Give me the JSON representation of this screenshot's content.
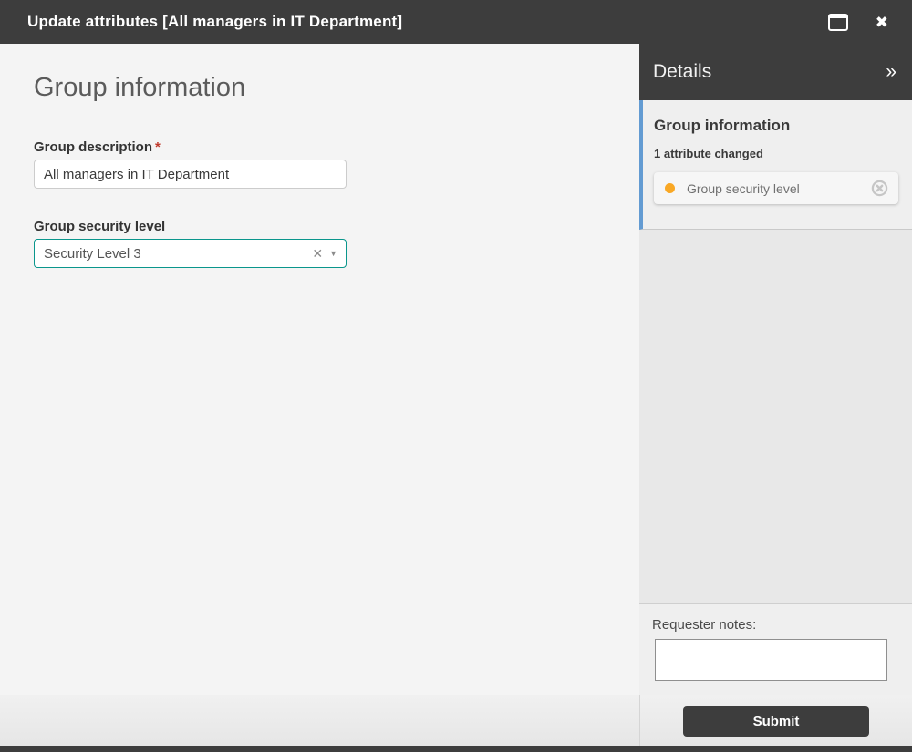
{
  "window": {
    "title": "Update attributes [All managers in IT Department]"
  },
  "icons": {
    "close": "✖",
    "chevron_double_right": "»",
    "clear": "✕",
    "caret_down": "▼"
  },
  "main": {
    "heading": "Group information",
    "fields": {
      "0": {
        "label": "Group description",
        "required_mark": "*",
        "value": "All managers in IT Department"
      },
      "1": {
        "label": "Group security level",
        "value": "Security Level 3"
      }
    }
  },
  "sidebar": {
    "header": "Details",
    "section": {
      "title": "Group information",
      "changed_summary": "1 attribute changed",
      "items": {
        "0": {
          "label": "Group security level",
          "status_color": "#f9a825"
        }
      }
    },
    "notes_label": "Requester notes:",
    "notes_value": ""
  },
  "footer": {
    "submit_label": "Submit"
  },
  "colors": {
    "titlebar": "#3d3d3d",
    "main_background": "#f4f4f4",
    "accent_teal": "#0a968c",
    "accent_blue": "#639bd2",
    "status_orange": "#f9a825",
    "required_red": "#c0392b"
  }
}
